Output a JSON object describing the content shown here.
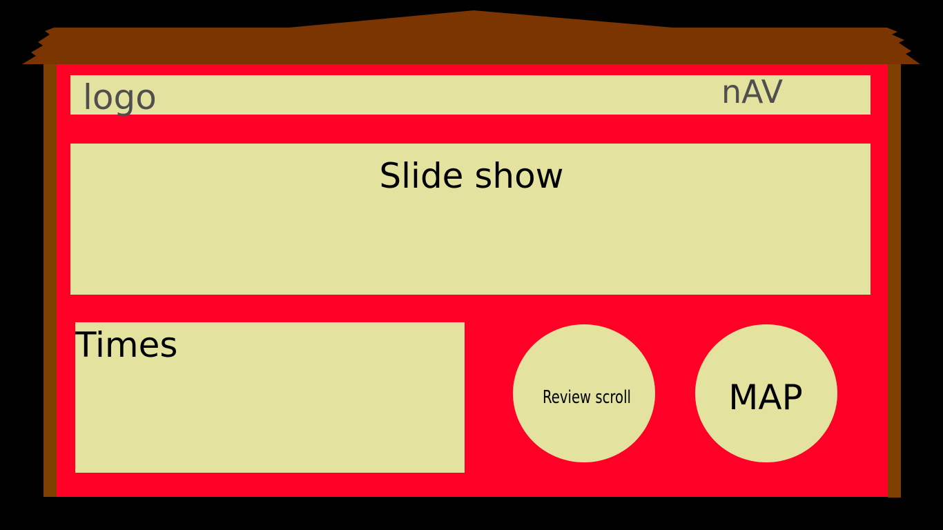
{
  "colors": {
    "background": "#000000",
    "wall": "#ff0026",
    "roof": "#7a3500",
    "post": "#7f3f00",
    "panel": "#e3e29e",
    "dark_text": "#4f4f4f",
    "text": "#000000"
  },
  "header": {
    "logo_label": "logo",
    "nav_label": "nAV"
  },
  "slideshow": {
    "label": "Slide show"
  },
  "times": {
    "label": "Times"
  },
  "review": {
    "label": "Review scroll"
  },
  "map": {
    "label": "MAP"
  }
}
